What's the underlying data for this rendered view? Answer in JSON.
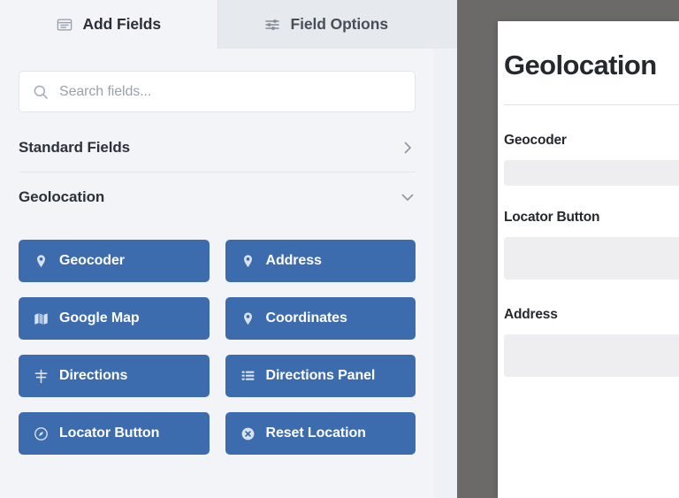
{
  "builder": {
    "tabs": [
      {
        "label": "Add Fields",
        "icon": "fields-list-icon",
        "active": true
      },
      {
        "label": "Field Options",
        "icon": "sliders-icon",
        "active": false
      }
    ],
    "search": {
      "placeholder": "Search fields...",
      "value": "",
      "icon": "search-icon"
    },
    "sections": [
      {
        "title": "Standard Fields",
        "state": "collapsed",
        "chevron": "chevron-right-icon"
      },
      {
        "title": "Geolocation",
        "state": "expanded",
        "chevron": "chevron-down-icon"
      }
    ],
    "geolocation_fields": [
      {
        "label": "Geocoder",
        "icon": "map-pin-icon"
      },
      {
        "label": "Address",
        "icon": "map-pin-icon"
      },
      {
        "label": "Google Map",
        "icon": "folded-map-icon"
      },
      {
        "label": "Coordinates",
        "icon": "map-pin-icon"
      },
      {
        "label": "Directions",
        "icon": "signpost-icon"
      },
      {
        "label": "Directions Panel",
        "icon": "list-lines-icon"
      },
      {
        "label": "Locator Button",
        "icon": "compass-icon"
      },
      {
        "label": "Reset Location",
        "icon": "close-circle-icon"
      }
    ]
  },
  "preview": {
    "title": "Geolocation",
    "fields": [
      {
        "label": "Geocoder",
        "value": ""
      },
      {
        "label": "Locator Button",
        "value": ""
      },
      {
        "label": "Address",
        "value": ""
      }
    ]
  },
  "colors": {
    "field_button_blue": "#3c6bae",
    "panel_background": "#f2f4f8",
    "tab_inactive": "#e6e9ee",
    "preview_frame_gray": "#6b6a69",
    "preview_input_gray": "#eeeef0"
  }
}
